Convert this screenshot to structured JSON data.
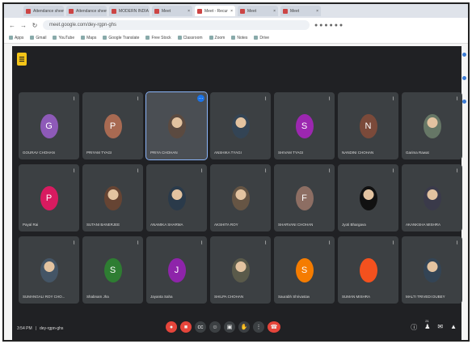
{
  "browser": {
    "tabs": [
      {
        "label": "Attendance sheet",
        "active": false
      },
      {
        "label": "Attendance sheet",
        "active": false
      },
      {
        "label": "MODERN INDIA",
        "active": false
      },
      {
        "label": "Meet",
        "active": false
      },
      {
        "label": "Meet - Recur",
        "active": true
      },
      {
        "label": "Meet",
        "active": false
      },
      {
        "label": "Meet",
        "active": false
      }
    ],
    "url": "meet.google.com/dey-rgpn-ghs",
    "bookmarks": [
      "Apps",
      "Gmail",
      "YouTube",
      "Maps",
      "Google Translate",
      "Free Stock",
      "Classroom",
      "Zoom",
      "Notes",
      "Drive"
    ]
  },
  "meet": {
    "logo_glyph": "☰",
    "tiles": [
      {
        "initial": "G",
        "color": "#8e5ab8",
        "name": "GOURAV CHOHAN",
        "photo": false
      },
      {
        "initial": "P",
        "color": "#a86a52",
        "name": "PRIYAM TYAGI",
        "photo": false
      },
      {
        "initial": "",
        "color": "#5b4a40",
        "name": "PRIYA CHOHAN",
        "photo": true,
        "selected": true
      },
      {
        "initial": "",
        "color": "#334455",
        "name": "ANSHIKA TYAGI",
        "photo": true
      },
      {
        "initial": "S",
        "color": "#9c27b0",
        "name": "SHIVAM TYAGI",
        "photo": false
      },
      {
        "initial": "N",
        "color": "#7b4a3a",
        "name": "NANDINI CHOHAN",
        "photo": false
      },
      {
        "initial": "",
        "color": "#667766",
        "name": "Garima Rawat",
        "photo": true
      },
      {
        "initial": "P",
        "color": "#d81b60",
        "name": "Payal Rai",
        "photo": false
      },
      {
        "initial": "",
        "color": "#664433",
        "name": "SUTANI BANERJEE",
        "photo": true
      },
      {
        "initial": "",
        "color": "#2a3a4a",
        "name": "ANAMIKA SHARMA",
        "photo": true
      },
      {
        "initial": "",
        "color": "#665544",
        "name": "AKSHITA ROY",
        "photo": true
      },
      {
        "initial": "F",
        "color": "#8d6e63",
        "name": "SHARVANI CHOHAN",
        "photo": false
      },
      {
        "initial": "",
        "color": "#111111",
        "name": "Jyoti Bhargava",
        "photo": true
      },
      {
        "initial": "",
        "color": "#3a3a4a",
        "name": "AKANKSHA MISHRA",
        "photo": true
      },
      {
        "initial": "",
        "color": "#445566",
        "name": "SUMANGALI ROY CHO...",
        "photo": true
      },
      {
        "initial": "S",
        "color": "#2e7d32",
        "name": "Shabnam Jha",
        "photo": false
      },
      {
        "initial": "J",
        "color": "#8e24aa",
        "name": "Jayanta Saha",
        "photo": false
      },
      {
        "initial": "",
        "color": "#5a5a4a",
        "name": "SHILPA CHOHAN",
        "photo": true
      },
      {
        "initial": "S",
        "color": "#f57c00",
        "name": "Saurabh Shrivastav",
        "photo": false
      },
      {
        "initial": "",
        "color": "#f4511e",
        "name": "SUMAN MISHRA",
        "photo": false
      },
      {
        "initial": "",
        "color": "#334455",
        "name": "MALTI TRIVEDI DUBEY",
        "photo": true
      }
    ],
    "time": "3:54 PM",
    "meeting_code": "dey-rgpn-ghs",
    "controls": [
      {
        "name": "mic-button",
        "glyph": "●",
        "red": true
      },
      {
        "name": "camera-button",
        "glyph": "■",
        "red": true
      },
      {
        "name": "captions-button",
        "glyph": "cc",
        "red": false
      },
      {
        "name": "emoji-button",
        "glyph": "☺",
        "red": false
      },
      {
        "name": "present-button",
        "glyph": "▣",
        "red": false
      },
      {
        "name": "raise-hand-button",
        "glyph": "✋",
        "red": false
      },
      {
        "name": "more-options-button",
        "glyph": "⋮",
        "red": false
      }
    ],
    "end_call_glyph": "☎",
    "participant_count": "21"
  }
}
